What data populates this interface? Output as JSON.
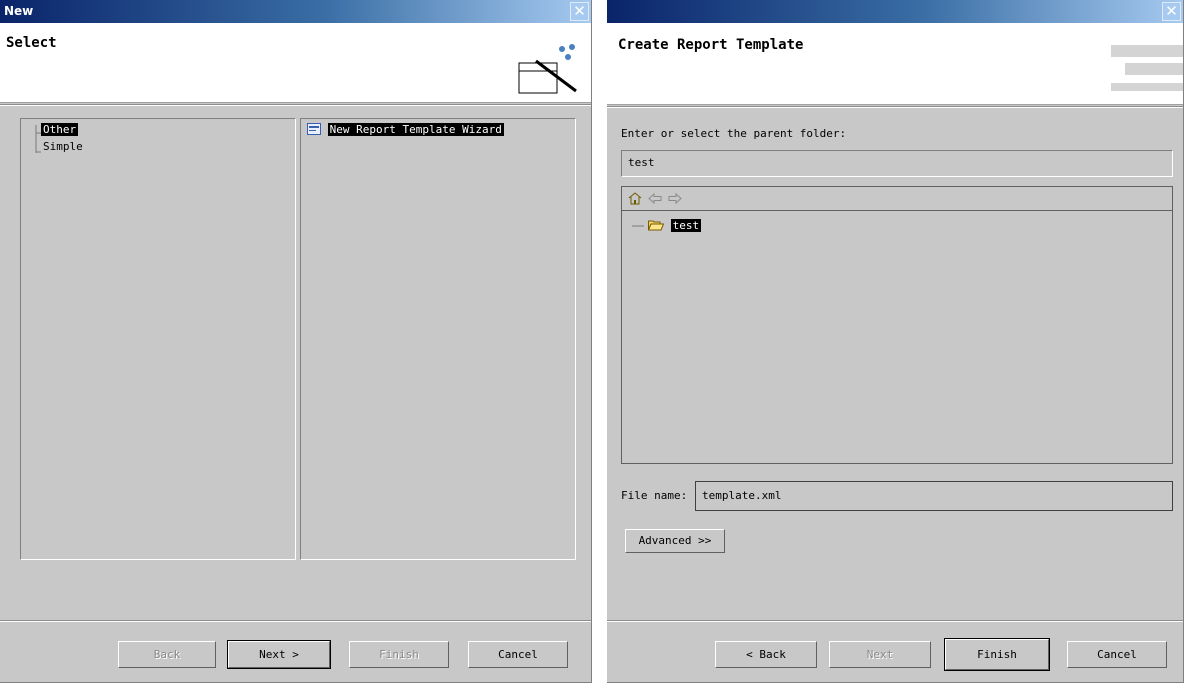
{
  "left_dialog": {
    "title": "New",
    "header_title": "Select",
    "categories": [
      {
        "label": "Other",
        "selected": true
      },
      {
        "label": "Simple",
        "selected": false
      }
    ],
    "wizards": [
      {
        "label": "New Report Template Wizard",
        "selected": true
      }
    ],
    "buttons": {
      "back": "Back",
      "next": "Next >",
      "finish": "Finish",
      "cancel": "Cancel"
    }
  },
  "right_dialog": {
    "title": "",
    "header_title": "Create Report Template",
    "folder_label": "Enter or select the parent folder:",
    "folder_value": "test",
    "tree_nav": [
      "home-icon",
      "back-arrow-icon",
      "forward-arrow-icon"
    ],
    "tree_items": [
      {
        "label": "test",
        "selected": true
      }
    ],
    "file_name_label": "File name:",
    "file_name_value": "template.xml",
    "advanced_button": "Advanced >>",
    "buttons": {
      "back": "< Back",
      "next": "Next",
      "finish": "Finish",
      "cancel": "Cancel"
    }
  },
  "colors": {
    "titlebar_start": "#0a246a",
    "titlebar_end": "#a6caf0",
    "dialog_bg": "#c8c8c8",
    "selection_bg": "#000000"
  }
}
